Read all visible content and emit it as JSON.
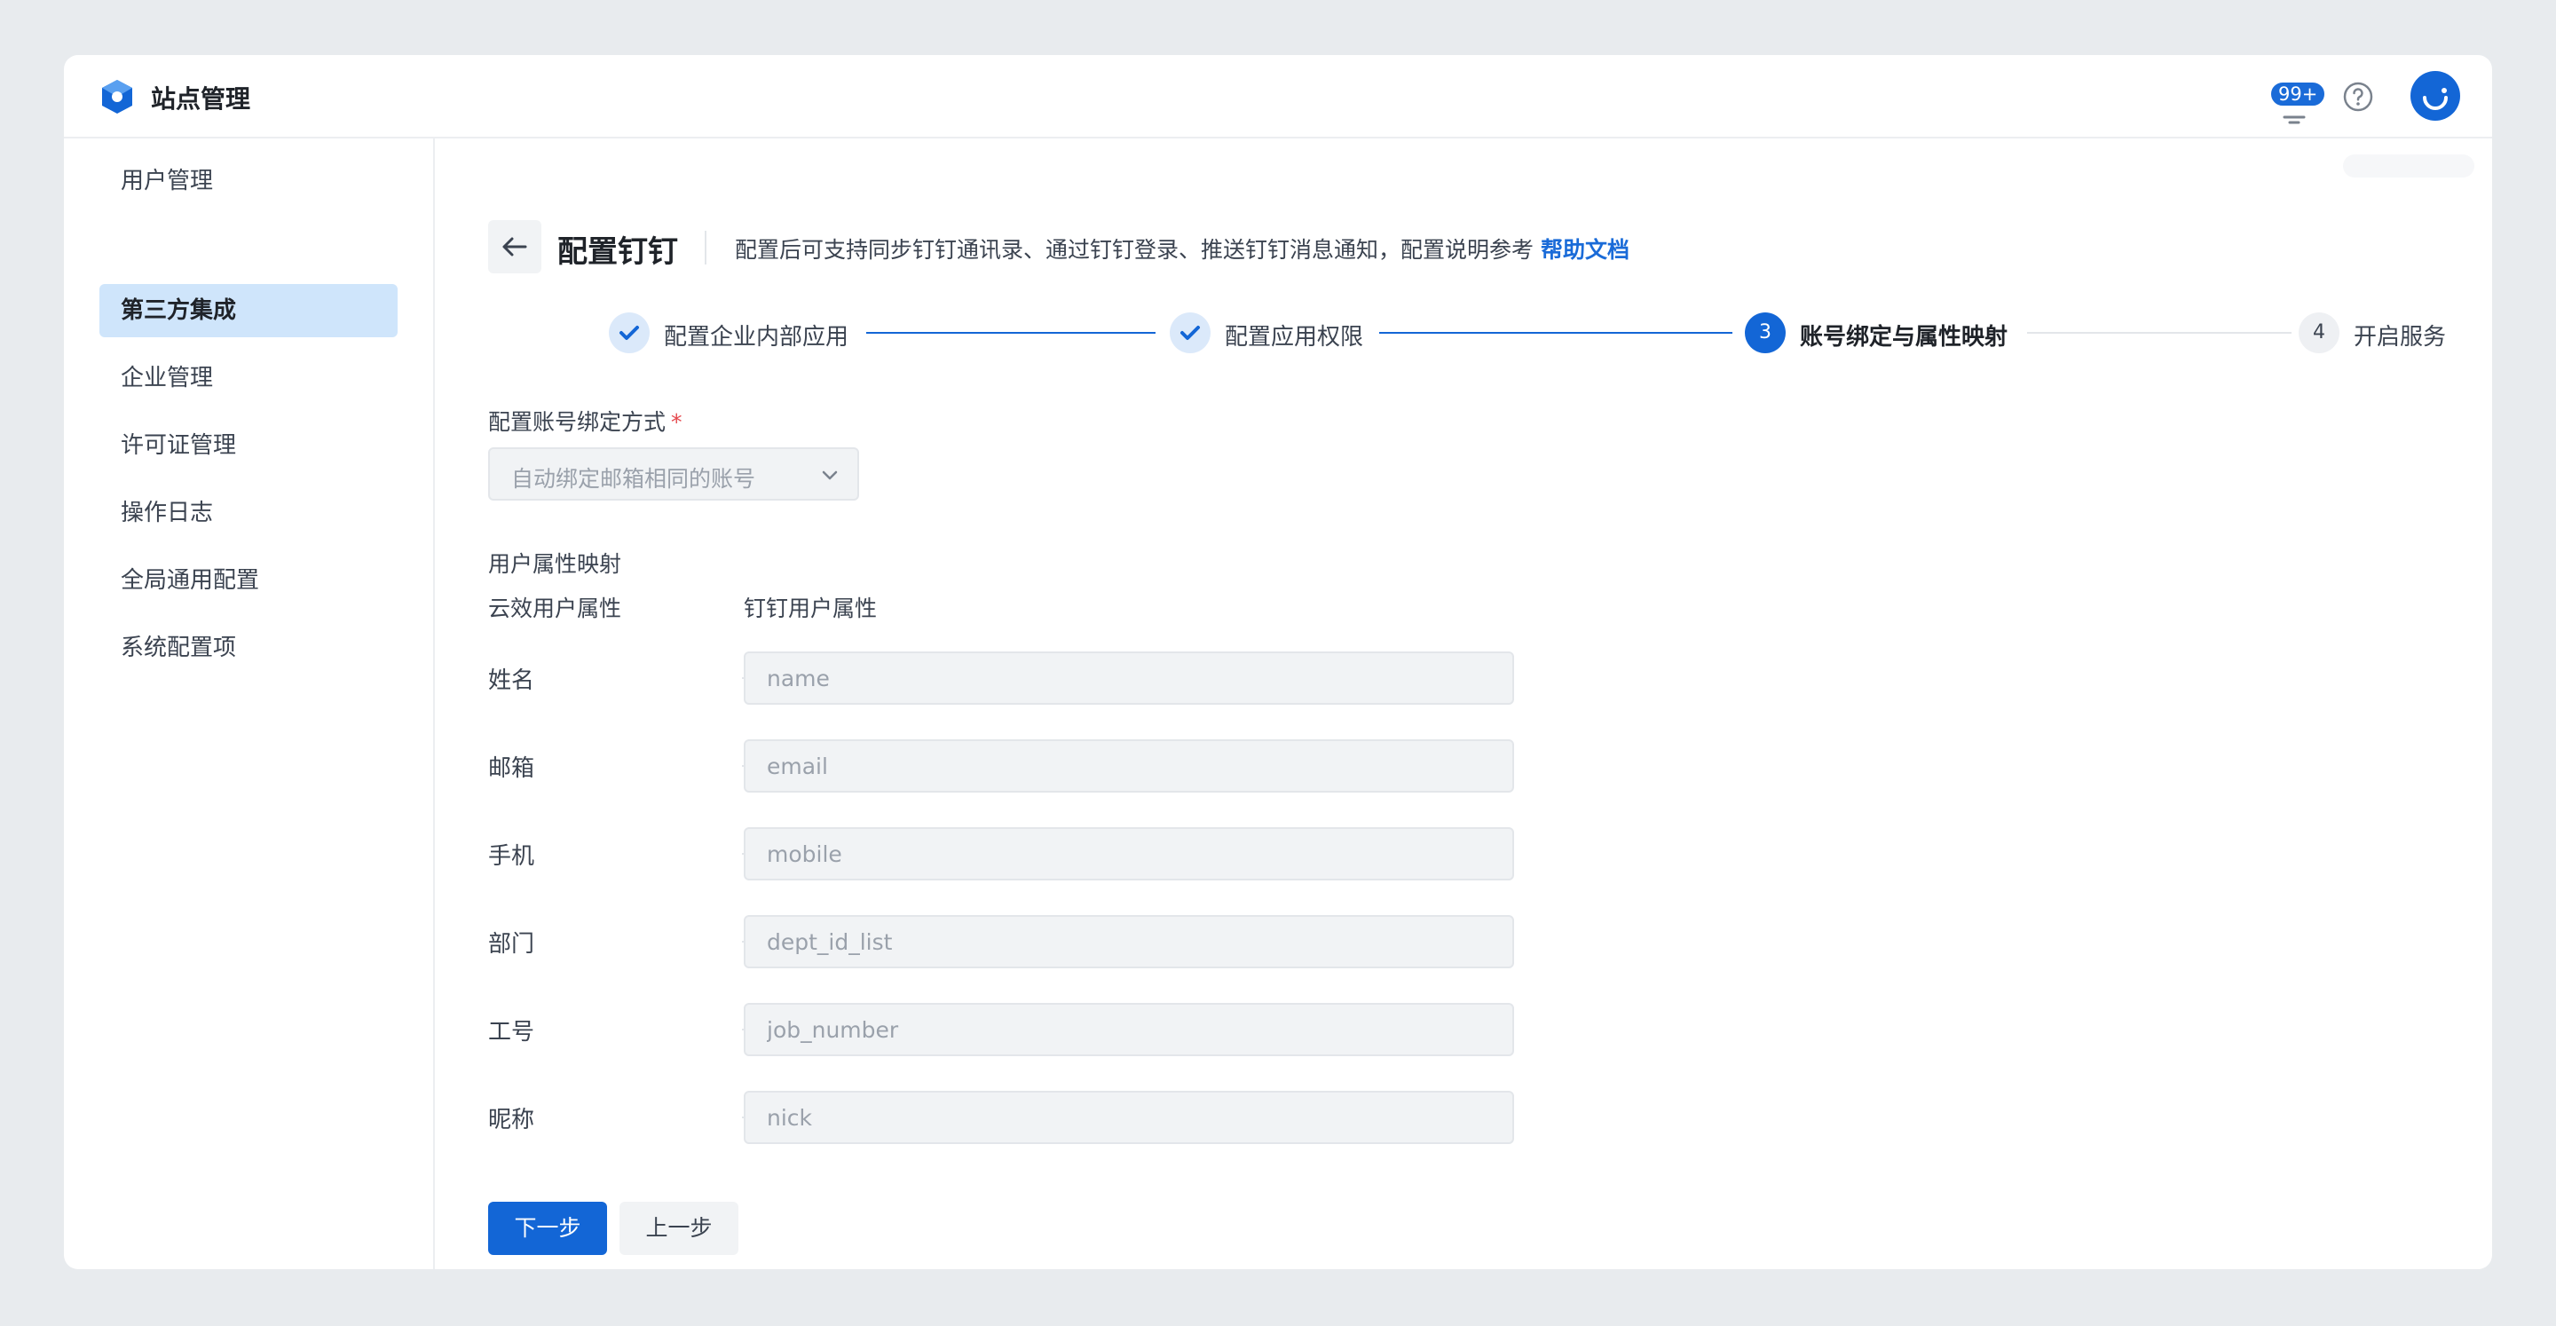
{
  "header": {
    "app_title": "站点管理",
    "notification_count": "99+",
    "icons": {
      "logo": "app-logo-icon",
      "bell": "bell-icon",
      "help": "help-icon",
      "avatar": "avatar-icon"
    },
    "accent_color": "#1366d6"
  },
  "sidebar": {
    "items": [
      {
        "label": "用户管理",
        "active": false
      },
      {
        "label": "第三方集成",
        "active": true
      },
      {
        "label": "企业管理",
        "active": false
      },
      {
        "label": "许可证管理",
        "active": false
      },
      {
        "label": "操作日志",
        "active": false
      },
      {
        "label": "全局通用配置",
        "active": false
      },
      {
        "label": "系统配置项",
        "active": false
      }
    ]
  },
  "page": {
    "title": "配置钉钉",
    "description": "配置后可支持同步钉钉通讯录、通过钉钉登录、推送钉钉消息通知，配置说明参考",
    "help_link": "帮助文档"
  },
  "steps": [
    {
      "label": "配置企业内部应用",
      "status": "done",
      "number": "1"
    },
    {
      "label": "配置应用权限",
      "status": "done",
      "number": "2"
    },
    {
      "label": "账号绑定与属性映射",
      "status": "current",
      "number": "3"
    },
    {
      "label": "开启服务",
      "status": "todo",
      "number": "4"
    }
  ],
  "form": {
    "binding_label": "配置账号绑定方式",
    "binding_required_mark": "*",
    "binding_value": "自动绑定邮箱相同的账号",
    "mapping_title": "用户属性映射",
    "col_left": "云效用户属性",
    "col_right": "钉钉用户属性",
    "mappings": [
      {
        "label": "姓名",
        "placeholder": "name"
      },
      {
        "label": "邮箱",
        "placeholder": "email"
      },
      {
        "label": "手机",
        "placeholder": "mobile"
      },
      {
        "label": "部门",
        "placeholder": "dept_id_list"
      },
      {
        "label": "工号",
        "placeholder": "job_number"
      },
      {
        "label": "昵称",
        "placeholder": "nick"
      }
    ]
  },
  "actions": {
    "next": "下一步",
    "prev": "上一步"
  }
}
